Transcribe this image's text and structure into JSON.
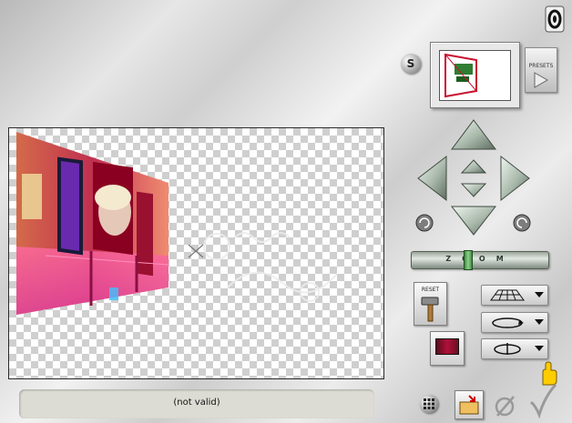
{
  "header": {
    "help_icon": "help-icon",
    "s_label": "S"
  },
  "preset": {
    "button_label": "PRESETS"
  },
  "navigation": {
    "up": "arrow-up-icon",
    "down": "arrow-down-icon",
    "left": "arrow-left-icon",
    "right": "arrow-right-icon",
    "rotate_left": "rotate-left-icon",
    "rotate_right": "rotate-right-icon"
  },
  "zoom": {
    "label": "ZOOM",
    "level": 0.4
  },
  "tools": {
    "reset_label": "RESET",
    "perspective_icon": "perspective-grid-icon",
    "rotate_icon": "rotate-ellipse-icon",
    "flip_icon": "flip-icon"
  },
  "status": {
    "text": "(not valid)"
  },
  "bottom": {
    "grid_icon": "grid-icon",
    "open_icon": "open-folder-icon",
    "cancel_icon": "cancel-icon",
    "ok_icon": "ok-checkmark-icon",
    "pointer_icon": "pointing-hand-icon"
  },
  "colors": {
    "accent_green": "#8fb08f",
    "frame_red": "#b0103a",
    "panel_gray": "#dcdcd4"
  }
}
